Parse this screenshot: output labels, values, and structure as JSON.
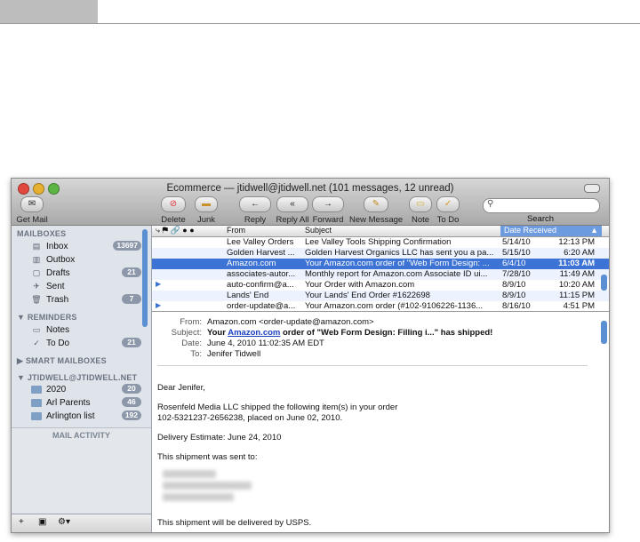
{
  "window": {
    "title": "Ecommerce — jtidwell@jtidwell.net (101 messages, 12 unread)"
  },
  "toolbar": {
    "get_mail": "Get Mail",
    "delete": "Delete",
    "junk": "Junk",
    "reply": "Reply",
    "reply_all": "Reply All",
    "forward": "Forward",
    "new_message": "New Message",
    "note": "Note",
    "to_do": "To Do",
    "search": "Search"
  },
  "sidebar": {
    "mailboxes_header": "MAILBOXES",
    "mailboxes": [
      {
        "label": "Inbox",
        "badge": "13697",
        "icon": "inbox-icon"
      },
      {
        "label": "Outbox",
        "badge": "",
        "icon": "outbox-icon"
      },
      {
        "label": "Drafts",
        "badge": "21",
        "icon": "drafts-icon"
      },
      {
        "label": "Sent",
        "badge": "",
        "icon": "sent-icon"
      },
      {
        "label": "Trash",
        "badge": "7",
        "icon": "trash-icon"
      }
    ],
    "reminders_header": "REMINDERS",
    "reminders": [
      {
        "label": "Notes",
        "badge": ""
      },
      {
        "label": "To Do",
        "badge": "21"
      }
    ],
    "smart_header": "SMART MAILBOXES",
    "account_header": "JTIDWELL@JTIDWELL.NET",
    "folders": [
      {
        "label": "2020",
        "badge": "20"
      },
      {
        "label": "Arl Parents",
        "badge": "46"
      },
      {
        "label": "Arlington list",
        "badge": "192"
      }
    ],
    "mail_activity": "MAIL ACTIVITY",
    "bottom": {
      "add": "+",
      "mailbox": "▣",
      "gear": "⚙▾"
    }
  },
  "message_list": {
    "columns": {
      "from": "From",
      "subject": "Subject",
      "date": "Date Received"
    },
    "rows": [
      {
        "from": "Lee Valley Orders",
        "subject": "Lee Valley Tools Shipping Confirmation",
        "date": "5/14/10",
        "time": "12:13 PM",
        "unread": false
      },
      {
        "from": "Golden Harvest ...",
        "subject": "Golden Harvest Organics LLC has sent you a pa...",
        "date": "5/15/10",
        "time": "6:20 AM",
        "unread": false
      },
      {
        "from": "Amazon.com",
        "subject": "Your Amazon.com order of \"Web Form Design: ...",
        "date": "6/4/10",
        "time": "11:03 AM",
        "unread": false
      },
      {
        "from": "associates-autor...",
        "subject": "Monthly report for Amazon.com Associate ID ui...",
        "date": "7/28/10",
        "time": "11:49 AM",
        "unread": false
      },
      {
        "from": "auto-confirm@a...",
        "subject": "Your Order with Amazon.com",
        "date": "8/9/10",
        "time": "10:20 AM",
        "unread": true
      },
      {
        "from": "Lands' End",
        "subject": "Your Lands' End Order #1622698",
        "date": "8/9/10",
        "time": "11:15 PM",
        "unread": false
      },
      {
        "from": "order-update@a...",
        "subject": "Your Amazon.com order (#102-9106226-1136...",
        "date": "8/16/10",
        "time": "4:51 PM",
        "unread": true
      }
    ],
    "selected_index": 2
  },
  "message": {
    "from_label": "From:",
    "from": "Amazon.com <order-update@amazon.com>",
    "subject_label": "Subject:",
    "subject_pre": "Your ",
    "subject_link": "Amazon.com",
    "subject_post": " order of \"Web Form Design: Filling i...\" has shipped!",
    "date_label": "Date:",
    "date": "June 4, 2010 11:02:35 AM EDT",
    "to_label": "To:",
    "to": "Jenifer Tidwell",
    "greeting": "Dear Jenifer,",
    "line1": "Rosenfeld Media LLC shipped the following item(s) in your order",
    "line2": "102-5321237-2656238, placed on June 02, 2010.",
    "estimate": "Delivery Estimate: June 24, 2010",
    "sent_to": "This shipment was sent to:",
    "delivered": "This shipment will be delivered by USPS."
  },
  "colors": {
    "selection": "#3d73d4",
    "badge": "#8c98aa",
    "sidebar_bg": "#dfe4eb"
  }
}
